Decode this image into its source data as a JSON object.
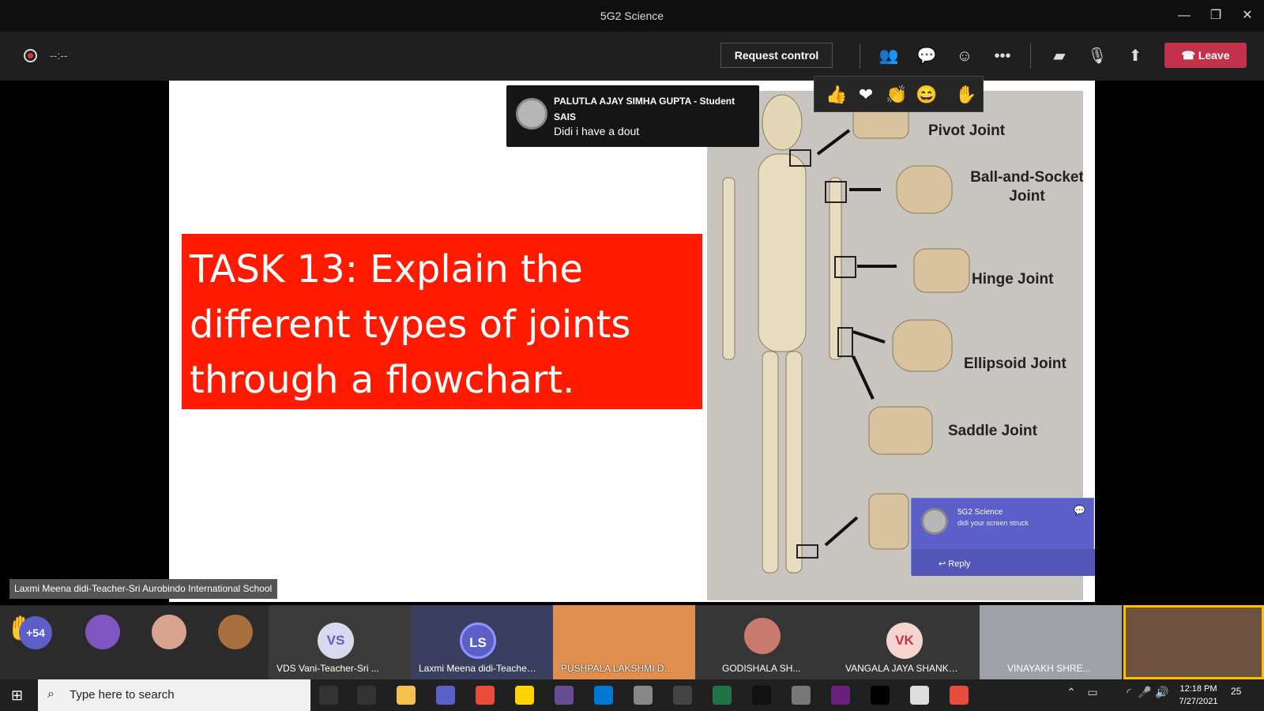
{
  "window": {
    "title": "5G2 Science"
  },
  "toolbar": {
    "timer": "--:--",
    "request_label": "Request control",
    "leave_label": "Leave"
  },
  "slide": {
    "task_text": "TASK 13: Explain the different types of joints through a flowchart.",
    "labels": [
      "Pivot Joint",
      "Ball-and-Socket Joint",
      "Hinge Joint",
      "Ellipsoid Joint",
      "Saddle Joint"
    ]
  },
  "notification": {
    "name": "PALUTLA AJAY SIMHA GUPTA - Student SAIS",
    "message": "Didi i have a dout"
  },
  "chat": {
    "name": "5G2 Science",
    "message": "didi your screen struck",
    "reply_label": "Reply"
  },
  "presenter": {
    "caption": "Laxmi Meena didi-Teacher-Sri Aurobindo International School"
  },
  "participants": [
    {
      "label": "+54"
    },
    {
      "label": "VDS Vani-Teacher-Sri ..."
    },
    {
      "label": "Laxmi Meena didi-Teacher..."
    },
    {
      "label": "PUSHPALA LAKSHMI DHA..."
    },
    {
      "label": "GODISHALA SH..."
    },
    {
      "label": "VANGALA JAYA SHANKAR..."
    },
    {
      "label": "VINAYAKH SHRE..."
    }
  ],
  "participant_initials": {
    "vs": "VS",
    "ls": "LS",
    "vk": "VK"
  },
  "taskbar": {
    "search_placeholder": "Type here to search",
    "time": "12:18 PM",
    "date": "7/27/2021",
    "notifications": "25"
  },
  "colors": {
    "leave": "#c4314b",
    "task": "#ff1a00",
    "chat": "#5b5fc7"
  },
  "icons": [
    "record-icon",
    "people-icon",
    "chat-icon",
    "reactions-icon",
    "more-icon",
    "camera-icon",
    "mic-off-icon",
    "share-icon",
    "phone-icon"
  ]
}
